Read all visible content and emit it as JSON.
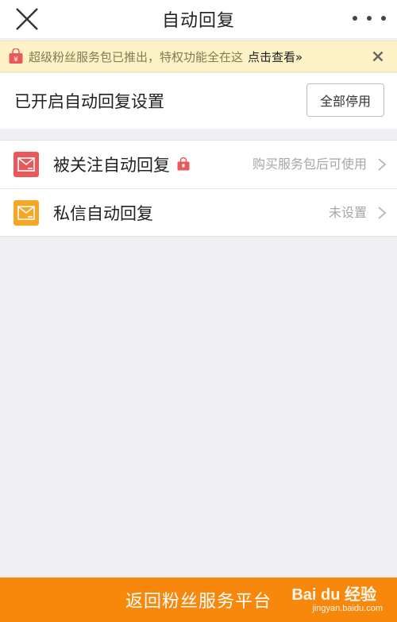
{
  "topbar": {
    "title": "自动回复",
    "close_icon": "close-icon",
    "more_icon": "more-dots-icon"
  },
  "notice": {
    "text": "超级粉丝服务包已推出，特权功能全在这",
    "link": "点击查看»",
    "icon": "shopping-bag-icon",
    "dismiss_icon": "close-icon"
  },
  "status": {
    "label": "已开启自动回复设置",
    "stop_button": "全部停用"
  },
  "list": {
    "items": [
      {
        "name": "被关注自动回复",
        "hint": "购买服务包后可使用",
        "icon": "mail-icon",
        "icon_color": "#e9585a",
        "locked": true
      },
      {
        "name": "私信自动回复",
        "hint": "未设置",
        "icon": "mail-icon",
        "icon_color": "#f6a623",
        "locked": false
      }
    ]
  },
  "bottom": {
    "label": "返回粉丝服务平台"
  },
  "watermark": {
    "brand": "Bai du 经验",
    "url": "jingyan.baidu.com"
  },
  "colors": {
    "accent": "#f8880c",
    "notice_bg": "#fdf2c6",
    "page_bg": "#efeff4"
  }
}
